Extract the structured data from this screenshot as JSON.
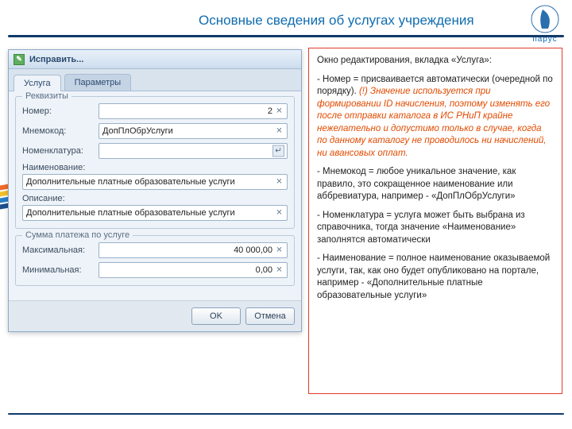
{
  "slide": {
    "title": "Основные сведения об услугах учреждения",
    "logo_label": "парус"
  },
  "window": {
    "title": "Исправить...",
    "tabs": {
      "service": "Услуга",
      "params": "Параметры"
    },
    "group_requisites": "Реквизиты",
    "labels": {
      "number": "Номер:",
      "mnemo": "Мнемокод:",
      "nomenclature": "Номенклатура:",
      "name": "Наименование:",
      "description": "Описание:"
    },
    "values": {
      "number": "2",
      "mnemo": "ДопПлОбрУслуги",
      "nomenclature": "",
      "name": "Дополнительные платные образовательные услуги",
      "description": "Дополнительные платные образовательные услуги"
    },
    "group_payment": "Сумма платежа по услуге",
    "labels2": {
      "max": "Максимальная:",
      "min": "Минимальная:"
    },
    "values2": {
      "max": "40 000,00",
      "min": "0,00"
    },
    "buttons": {
      "ok": "OK",
      "cancel": "Отмена"
    }
  },
  "info": {
    "p1": "Окно редактирования, вкладка «Услуга»:",
    "p2a": "-   Номер = присваивается автоматически (очередной по порядку). ",
    "p2b": "(!) Значение используется при формировании ID начисления, поэтому изменять его после отправки каталога в ИС РНиП крайне нежелательно и допустимо только в случае, когда по данному каталогу не проводилось ни начислений, ни авансовых оплат.",
    "p3": "-  Мнемокод = любое уникальное значение, как правило, это сокращенное наименование или аббревиатура, например -  «ДопПлОбрУслуги»",
    "p4": "-  Номенклатура = услуга может быть выбрана из справочника, тогда значение «Наименование» заполнятся автоматически",
    "p5": "-   Наименование = полное наименование оказываемой услуги, так, как оно будет опубликовано на портале, например - «Дополнительные платные образовательные услуги»"
  }
}
